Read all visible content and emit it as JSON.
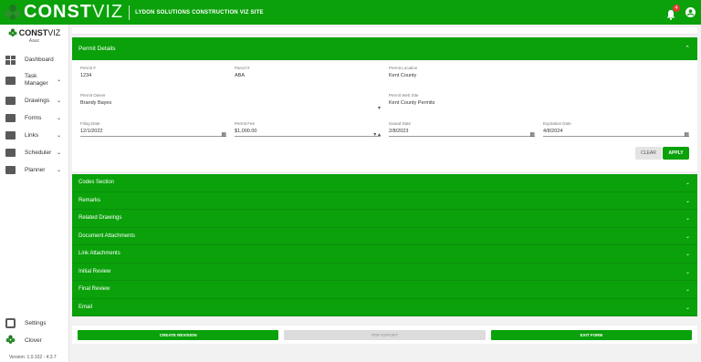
{
  "header": {
    "brand_main": "CONST",
    "brand_accent": "VIZ",
    "subtitle": "LYDON SOLUTIONS CONSTRUCTION VIZ SITE",
    "notification_count": "4"
  },
  "sidebar": {
    "brand_main": "CONST",
    "brand_accent": "VIZ",
    "user": "Aaac",
    "items": [
      {
        "label": "Dashboard"
      },
      {
        "label": "Task Manager"
      },
      {
        "label": "Drawings"
      },
      {
        "label": "Forms"
      },
      {
        "label": "Links"
      },
      {
        "label": "Scheduler"
      },
      {
        "label": "Planner"
      }
    ],
    "settings_label": "Settings",
    "account_label": "Clover",
    "version": "Version: 1.0.102 - 4.3.7"
  },
  "permit": {
    "title": "Permit Details",
    "fields": {
      "permit_no": {
        "label": "Permit #",
        "value": "1234"
      },
      "parcel_no": {
        "label": "Parcel #",
        "value": "ABA"
      },
      "permit_location": {
        "label": "Permit Location",
        "value": "Kent County"
      },
      "permit_owner": {
        "label": "Permit Owner",
        "value": "Brandy Bayes"
      },
      "permit_web_site": {
        "label": "Permit Web Site",
        "value": "Kent County Permits"
      },
      "filing_date": {
        "label": "Filing Date",
        "value": "12/1/2022"
      },
      "permit_fee": {
        "label": "Permit Fee",
        "value": "$1,000.00"
      },
      "issued_date": {
        "label": "Issued Date",
        "value": "2/8/2023"
      },
      "expiration_date": {
        "label": "Expiration Date",
        "value": "4/8/2024"
      }
    },
    "clear_label": "CLEAR",
    "apply_label": "APPLY"
  },
  "sections": [
    {
      "label": "Codes Section"
    },
    {
      "label": "Remarks"
    },
    {
      "label": "Related Drawings"
    },
    {
      "label": "Document Attachments"
    },
    {
      "label": "Link Attachments"
    },
    {
      "label": "Initial Review"
    },
    {
      "label": "Final Review"
    },
    {
      "label": "Email"
    }
  ],
  "actions": {
    "create_revision": "CREATE REVISION",
    "pdf_export": "PDF EXPORT",
    "exit_form": "EXIT FORM"
  },
  "colors": {
    "primary": "#0aa10a",
    "badge": "#e53935"
  }
}
